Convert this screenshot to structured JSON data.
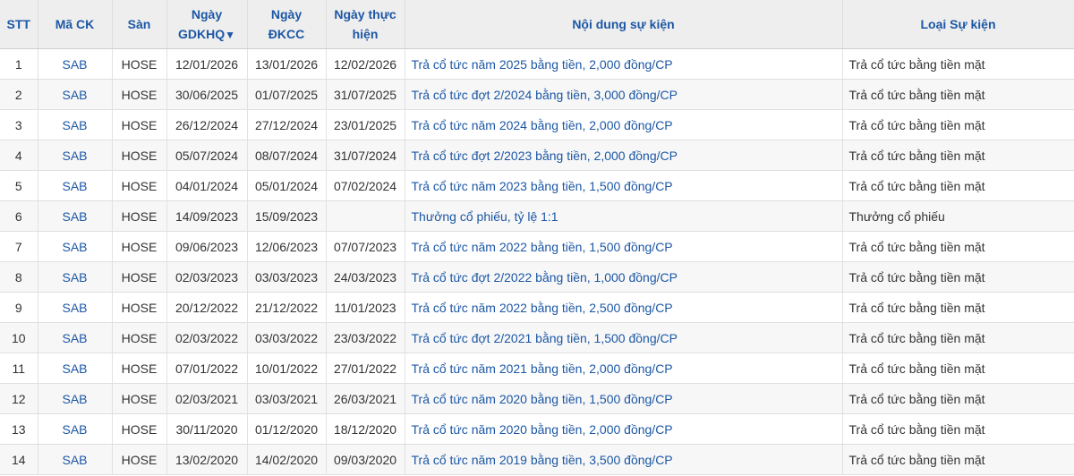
{
  "header": {
    "stt": "STT",
    "ma_ck": "Mã CK",
    "san": "Sàn",
    "ngay_gdkhq_line1": "Ngày",
    "ngay_gdkhq_line2": "GDKHQ",
    "sort_icon": "▼",
    "ngay_dkcc_line1": "Ngày",
    "ngay_dkcc_line2": "ĐKCC",
    "ngay_thuc_hien_line1": "Ngày thực",
    "ngay_thuc_hien_line2": "hiện",
    "noi_dung": "Nội dung sự kiện",
    "loai_su_kien": "Loại Sự kiện"
  },
  "rows": [
    {
      "stt": "1",
      "code": "SAB",
      "exchange": "HOSE",
      "gdkhq": "12/01/2026",
      "dkcc": "13/01/2026",
      "exec": "12/02/2026",
      "content": "Trả cổ tức năm 2025 bằng tiền, 2,000 đồng/CP",
      "type": "Trả cổ tức bằng tiền mặt"
    },
    {
      "stt": "2",
      "code": "SAB",
      "exchange": "HOSE",
      "gdkhq": "30/06/2025",
      "dkcc": "01/07/2025",
      "exec": "31/07/2025",
      "content": "Trả cổ tức đợt 2/2024 bằng tiền, 3,000 đồng/CP",
      "type": "Trả cổ tức bằng tiền mặt"
    },
    {
      "stt": "3",
      "code": "SAB",
      "exchange": "HOSE",
      "gdkhq": "26/12/2024",
      "dkcc": "27/12/2024",
      "exec": "23/01/2025",
      "content": "Trả cổ tức năm 2024 bằng tiền, 2,000 đồng/CP",
      "type": "Trả cổ tức bằng tiền mặt"
    },
    {
      "stt": "4",
      "code": "SAB",
      "exchange": "HOSE",
      "gdkhq": "05/07/2024",
      "dkcc": "08/07/2024",
      "exec": "31/07/2024",
      "content": "Trả cổ tức đợt 2/2023 bằng tiền, 2,000 đồng/CP",
      "type": "Trả cổ tức bằng tiền mặt"
    },
    {
      "stt": "5",
      "code": "SAB",
      "exchange": "HOSE",
      "gdkhq": "04/01/2024",
      "dkcc": "05/01/2024",
      "exec": "07/02/2024",
      "content": "Trả cổ tức năm 2023 bằng tiền, 1,500 đồng/CP",
      "type": "Trả cổ tức bằng tiền mặt"
    },
    {
      "stt": "6",
      "code": "SAB",
      "exchange": "HOSE",
      "gdkhq": "14/09/2023",
      "dkcc": "15/09/2023",
      "exec": "",
      "content": "Thưởng cổ phiếu, tỷ lệ 1:1",
      "type": "Thưởng cổ phiếu"
    },
    {
      "stt": "7",
      "code": "SAB",
      "exchange": "HOSE",
      "gdkhq": "09/06/2023",
      "dkcc": "12/06/2023",
      "exec": "07/07/2023",
      "content": "Trả cổ tức năm 2022 bằng tiền, 1,500 đồng/CP",
      "type": "Trả cổ tức bằng tiền mặt"
    },
    {
      "stt": "8",
      "code": "SAB",
      "exchange": "HOSE",
      "gdkhq": "02/03/2023",
      "dkcc": "03/03/2023",
      "exec": "24/03/2023",
      "content": "Trả cổ tức đợt 2/2022 bằng tiền, 1,000 đồng/CP",
      "type": "Trả cổ tức bằng tiền mặt"
    },
    {
      "stt": "9",
      "code": "SAB",
      "exchange": "HOSE",
      "gdkhq": "20/12/2022",
      "dkcc": "21/12/2022",
      "exec": "11/01/2023",
      "content": "Trả cổ tức năm 2022 bằng tiền, 2,500 đồng/CP",
      "type": "Trả cổ tức bằng tiền mặt"
    },
    {
      "stt": "10",
      "code": "SAB",
      "exchange": "HOSE",
      "gdkhq": "02/03/2022",
      "dkcc": "03/03/2022",
      "exec": "23/03/2022",
      "content": "Trả cổ tức đợt 2/2021 bằng tiền, 1,500 đồng/CP",
      "type": "Trả cổ tức bằng tiền mặt"
    },
    {
      "stt": "11",
      "code": "SAB",
      "exchange": "HOSE",
      "gdkhq": "07/01/2022",
      "dkcc": "10/01/2022",
      "exec": "27/01/2022",
      "content": "Trả cổ tức năm 2021 bằng tiền, 2,000 đồng/CP",
      "type": "Trả cổ tức bằng tiền mặt"
    },
    {
      "stt": "12",
      "code": "SAB",
      "exchange": "HOSE",
      "gdkhq": "02/03/2021",
      "dkcc": "03/03/2021",
      "exec": "26/03/2021",
      "content": "Trả cổ tức năm 2020 bằng tiền, 1,500 đồng/CP",
      "type": "Trả cổ tức bằng tiền mặt"
    },
    {
      "stt": "13",
      "code": "SAB",
      "exchange": "HOSE",
      "gdkhq": "30/11/2020",
      "dkcc": "01/12/2020",
      "exec": "18/12/2020",
      "content": "Trả cổ tức năm 2020 bằng tiền, 2,000 đồng/CP",
      "type": "Trả cổ tức bằng tiền mặt"
    },
    {
      "stt": "14",
      "code": "SAB",
      "exchange": "HOSE",
      "gdkhq": "13/02/2020",
      "dkcc": "14/02/2020",
      "exec": "09/03/2020",
      "content": "Trả cổ tức năm 2019 bằng tiền, 3,500 đồng/CP",
      "type": "Trả cổ tức bằng tiền mặt"
    }
  ],
  "colors": {
    "link": "#1c57a5",
    "header_bg": "#eeeeee",
    "stripe_bg": "#f7f7f7",
    "text": "#333333"
  }
}
